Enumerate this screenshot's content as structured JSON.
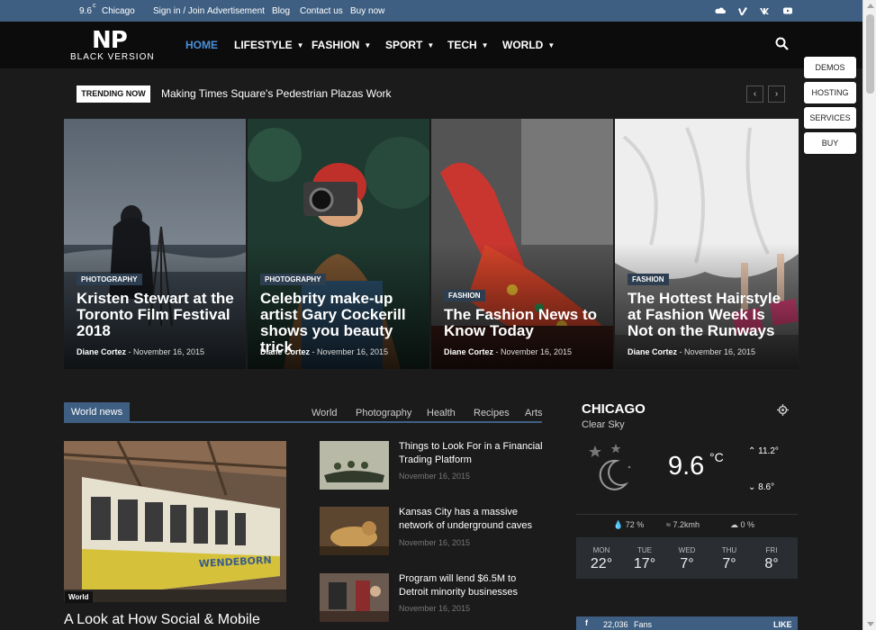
{
  "topbar": {
    "temp": "9.6",
    "temp_unit": "c",
    "city": "Chicago",
    "links": [
      "Sign in / Join",
      "Advertisement",
      "Blog",
      "Contact us",
      "Buy now"
    ],
    "social_icons": [
      "soundcloud-icon",
      "vimeo-icon",
      "vk-icon",
      "youtube-icon"
    ],
    "bg_color": "#3f5f82"
  },
  "header": {
    "logo_main": "NP",
    "logo_sub": "BLACK VERSION",
    "nav": [
      "HOME",
      "LIFESTYLE",
      "FASHION",
      "SPORT",
      "TECH",
      "WORLD"
    ],
    "active": "HOME",
    "accent": "#4a90d9"
  },
  "side_buttons": [
    "DEMOS",
    "HOSTING",
    "SERVICES",
    "BUY"
  ],
  "trending": {
    "label": "TRENDING NOW",
    "headline": "Making Times Square's Pedestrian Plazas Work",
    "prev": "‹",
    "next": "›"
  },
  "featured": [
    {
      "category": "PHOTOGRAPHY",
      "title": "Kristen Stewart at the Toronto Film Festival 2018",
      "author": "Diane Cortez",
      "date": "November 16, 2015"
    },
    {
      "category": "PHOTOGRAPHY",
      "title": "Celebrity make-up artist Gary Cockerill shows you beauty trick",
      "author": "Diane Cortez",
      "date": "November 16, 2015"
    },
    {
      "category": "FASHION",
      "title": "The Fashion News to Know Today",
      "author": "Diane Cortez",
      "date": "November 16, 2015"
    },
    {
      "category": "FASHION",
      "title": "The Hottest Hairstyle at Fashion Week Is Not on the Runways",
      "author": "Diane Cortez",
      "date": "November 16, 2015"
    }
  ],
  "world_news": {
    "tab": "World news",
    "filters": [
      "World",
      "Photography",
      "Health",
      "Recipes",
      "Arts"
    ],
    "main": {
      "badge": "World",
      "title": "A Look at How Social & Mobile"
    },
    "list": [
      {
        "title": "Things to Look For in a Financial Trading Platform",
        "date": "November 16, 2015"
      },
      {
        "title": "Kansas City has a massive network of underground caves",
        "date": "November 16, 2015"
      },
      {
        "title": "Program will lend $6.5M to Detroit minority businesses",
        "date": "November 16, 2015"
      }
    ]
  },
  "weather": {
    "city": "CHICAGO",
    "condition": "Clear Sky",
    "temp": "9.6",
    "unit": "°C",
    "high": "11.2°",
    "low": "8.6°",
    "humidity": "72 %",
    "wind": "7.2kmh",
    "clouds": "0 %",
    "forecast": [
      {
        "day": "MON",
        "temp": "22°"
      },
      {
        "day": "TUE",
        "temp": "17°"
      },
      {
        "day": "WED",
        "temp": "7°"
      },
      {
        "day": "THU",
        "temp": "7°"
      },
      {
        "day": "FRI",
        "temp": "8°"
      }
    ]
  },
  "facebook_bar": {
    "count": "22,036",
    "label": "Fans",
    "action": "LIKE"
  }
}
